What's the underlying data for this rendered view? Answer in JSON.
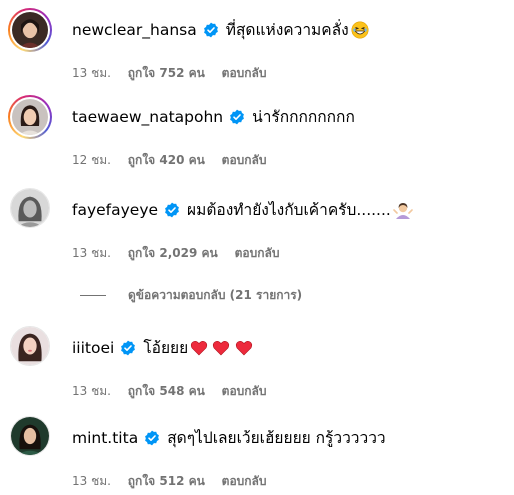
{
  "comments": [
    {
      "username": "newclear_hansa",
      "text": "ที่สุดแห่งความคลั่ง",
      "emoji": "laughing-emoji",
      "time": "13 ชม.",
      "likes": "ถูกใจ 752 คน",
      "reply": "ตอบกลับ"
    },
    {
      "username": "taewaew_natapohn",
      "text": "น่ารักกกกกกกก",
      "time": "12 ชม.",
      "likes": "ถูกใจ 420 คน",
      "reply": "ตอบกลับ"
    },
    {
      "username": "fayefayeye",
      "text": "ผมต้องทำยังไงกับเค้าครับ.......",
      "emoji": "person-shrugging-emoji",
      "time": "13 ชม.",
      "likes": "ถูกใจ 2,029 คน",
      "reply": "ตอบกลับ"
    },
    {
      "username": "iiitoei",
      "text": "โอ้ยยย",
      "emoji": "three-red-hearts-emoji",
      "time": "13 ชม.",
      "likes": "ถูกใจ 548 คน",
      "reply": "ตอบกลับ"
    },
    {
      "username": "mint.tita",
      "text": "สุดๆไปเลยเว้ยเฮ้ยยยย กรู้วววววว",
      "time": "13 ชม.",
      "likes": "ถูกใจ 512 คน",
      "reply": "ตอบกลับ"
    }
  ],
  "view_replies": "ดูข้อความตอบกลับ (21 รายการ)",
  "colors": {
    "verified": "#0095f6",
    "meta_text": "#737373",
    "heart": "#ed2a3c"
  }
}
